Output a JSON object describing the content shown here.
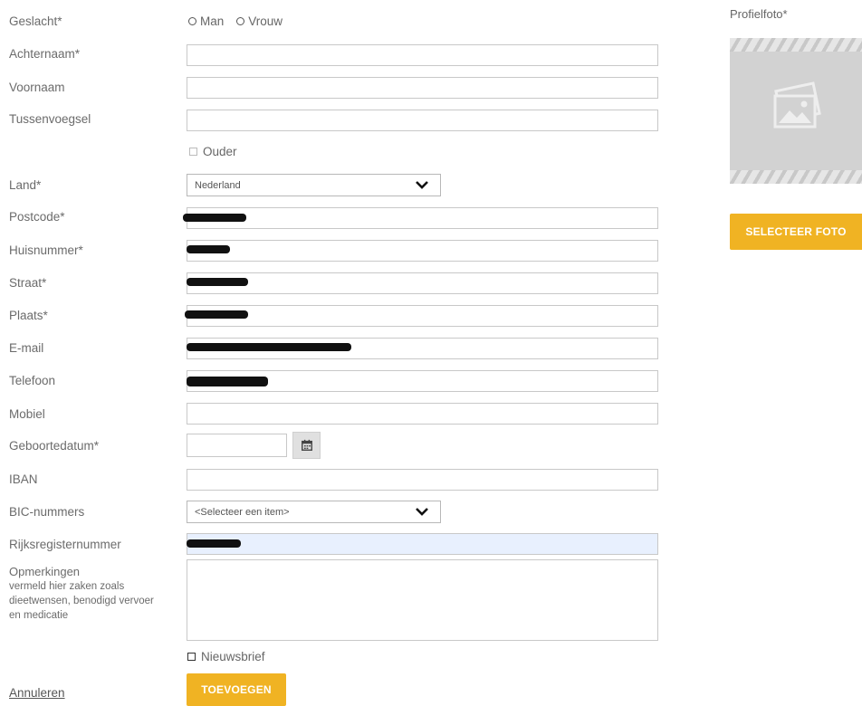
{
  "form": {
    "gender": {
      "label": "Geslacht*",
      "options": [
        "Man",
        "Vrouw"
      ]
    },
    "lastname": {
      "label": "Achternaam*",
      "value": ""
    },
    "firstname": {
      "label": "Voornaam",
      "value": ""
    },
    "infix": {
      "label": "Tussenvoegsel",
      "value": ""
    },
    "parent_checkbox": {
      "label": "Ouder",
      "checked": false
    },
    "country": {
      "label": "Land*",
      "selected": "Nederland"
    },
    "postcode": {
      "label": "Postcode*"
    },
    "housenumber": {
      "label": "Huisnummer*"
    },
    "street": {
      "label": "Straat*"
    },
    "city": {
      "label": "Plaats*"
    },
    "email": {
      "label": "E-mail"
    },
    "phone": {
      "label": "Telefoon"
    },
    "mobile": {
      "label": "Mobiel",
      "value": ""
    },
    "birthdate": {
      "label": "Geboortedatum*",
      "value": ""
    },
    "iban": {
      "label": "IBAN",
      "value": ""
    },
    "bic": {
      "label": "BIC-nummers",
      "selected": "<Selecteer een item>"
    },
    "national_id": {
      "label": "Rijksregisternummer"
    },
    "remarks": {
      "label": "Opmerkingen",
      "hint": "vermeld hier zaken zoals dieetwensen, benodigd vervoer en medicatie",
      "value": ""
    },
    "newsletter": {
      "label": "Nieuwsbrief",
      "checked": false
    },
    "cancel_label": "Annuleren",
    "submit_label": "TOEVOEGEN"
  },
  "photo": {
    "label": "Profielfoto*",
    "select_label": "SELECTEER FOTO",
    "placeholder_icon": "image-placeholder-icon"
  },
  "colors": {
    "accent": "#f0b323",
    "autofill_bg": "#e8f0fe"
  },
  "icons": {
    "calendar": "calendar-icon",
    "dropdown": "chevron-down-icon"
  }
}
